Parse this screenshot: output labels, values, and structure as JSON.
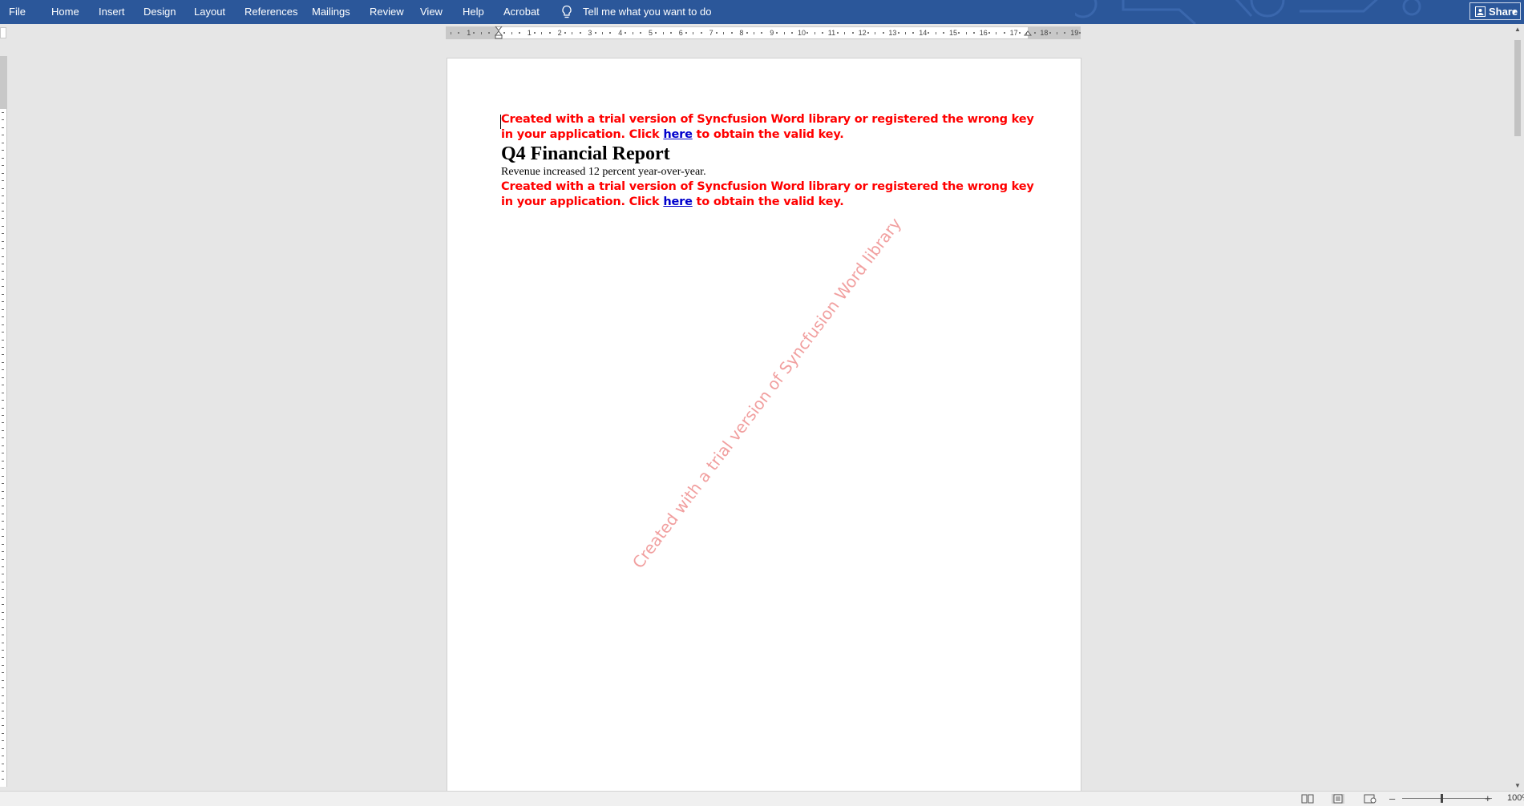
{
  "menu": {
    "items": [
      "File",
      "Home",
      "Insert",
      "Design",
      "Layout",
      "References",
      "Mailings",
      "Review",
      "View",
      "Help",
      "Acrobat"
    ],
    "tell_me": "Tell me what you want to do",
    "share": "Share"
  },
  "ruler": {
    "numbers": [
      "1",
      "1",
      "2",
      "3",
      "4",
      "5",
      "6",
      "7",
      "8",
      "9",
      "10",
      "11",
      "12",
      "13",
      "14",
      "15",
      "16",
      "17",
      "18",
      "19"
    ]
  },
  "document": {
    "warning_before": "Created with a trial version of Syncfusion Word library or registered the wrong key in your application. Click ",
    "warning_link": "here",
    "warning_after": " to obtain the valid key.",
    "heading": "Q4 Financial Report",
    "paragraph": "Revenue increased 12 percent year-over-year.",
    "watermark": "Created with a trial version of Syncfusion Word library"
  },
  "statusbar": {
    "zoom": "100%",
    "zoom_level_percent": 100
  },
  "colors": {
    "ribbon": "#2b579a",
    "warning_text": "#ff0000",
    "link": "#0000cc",
    "watermark": "#e65050"
  }
}
